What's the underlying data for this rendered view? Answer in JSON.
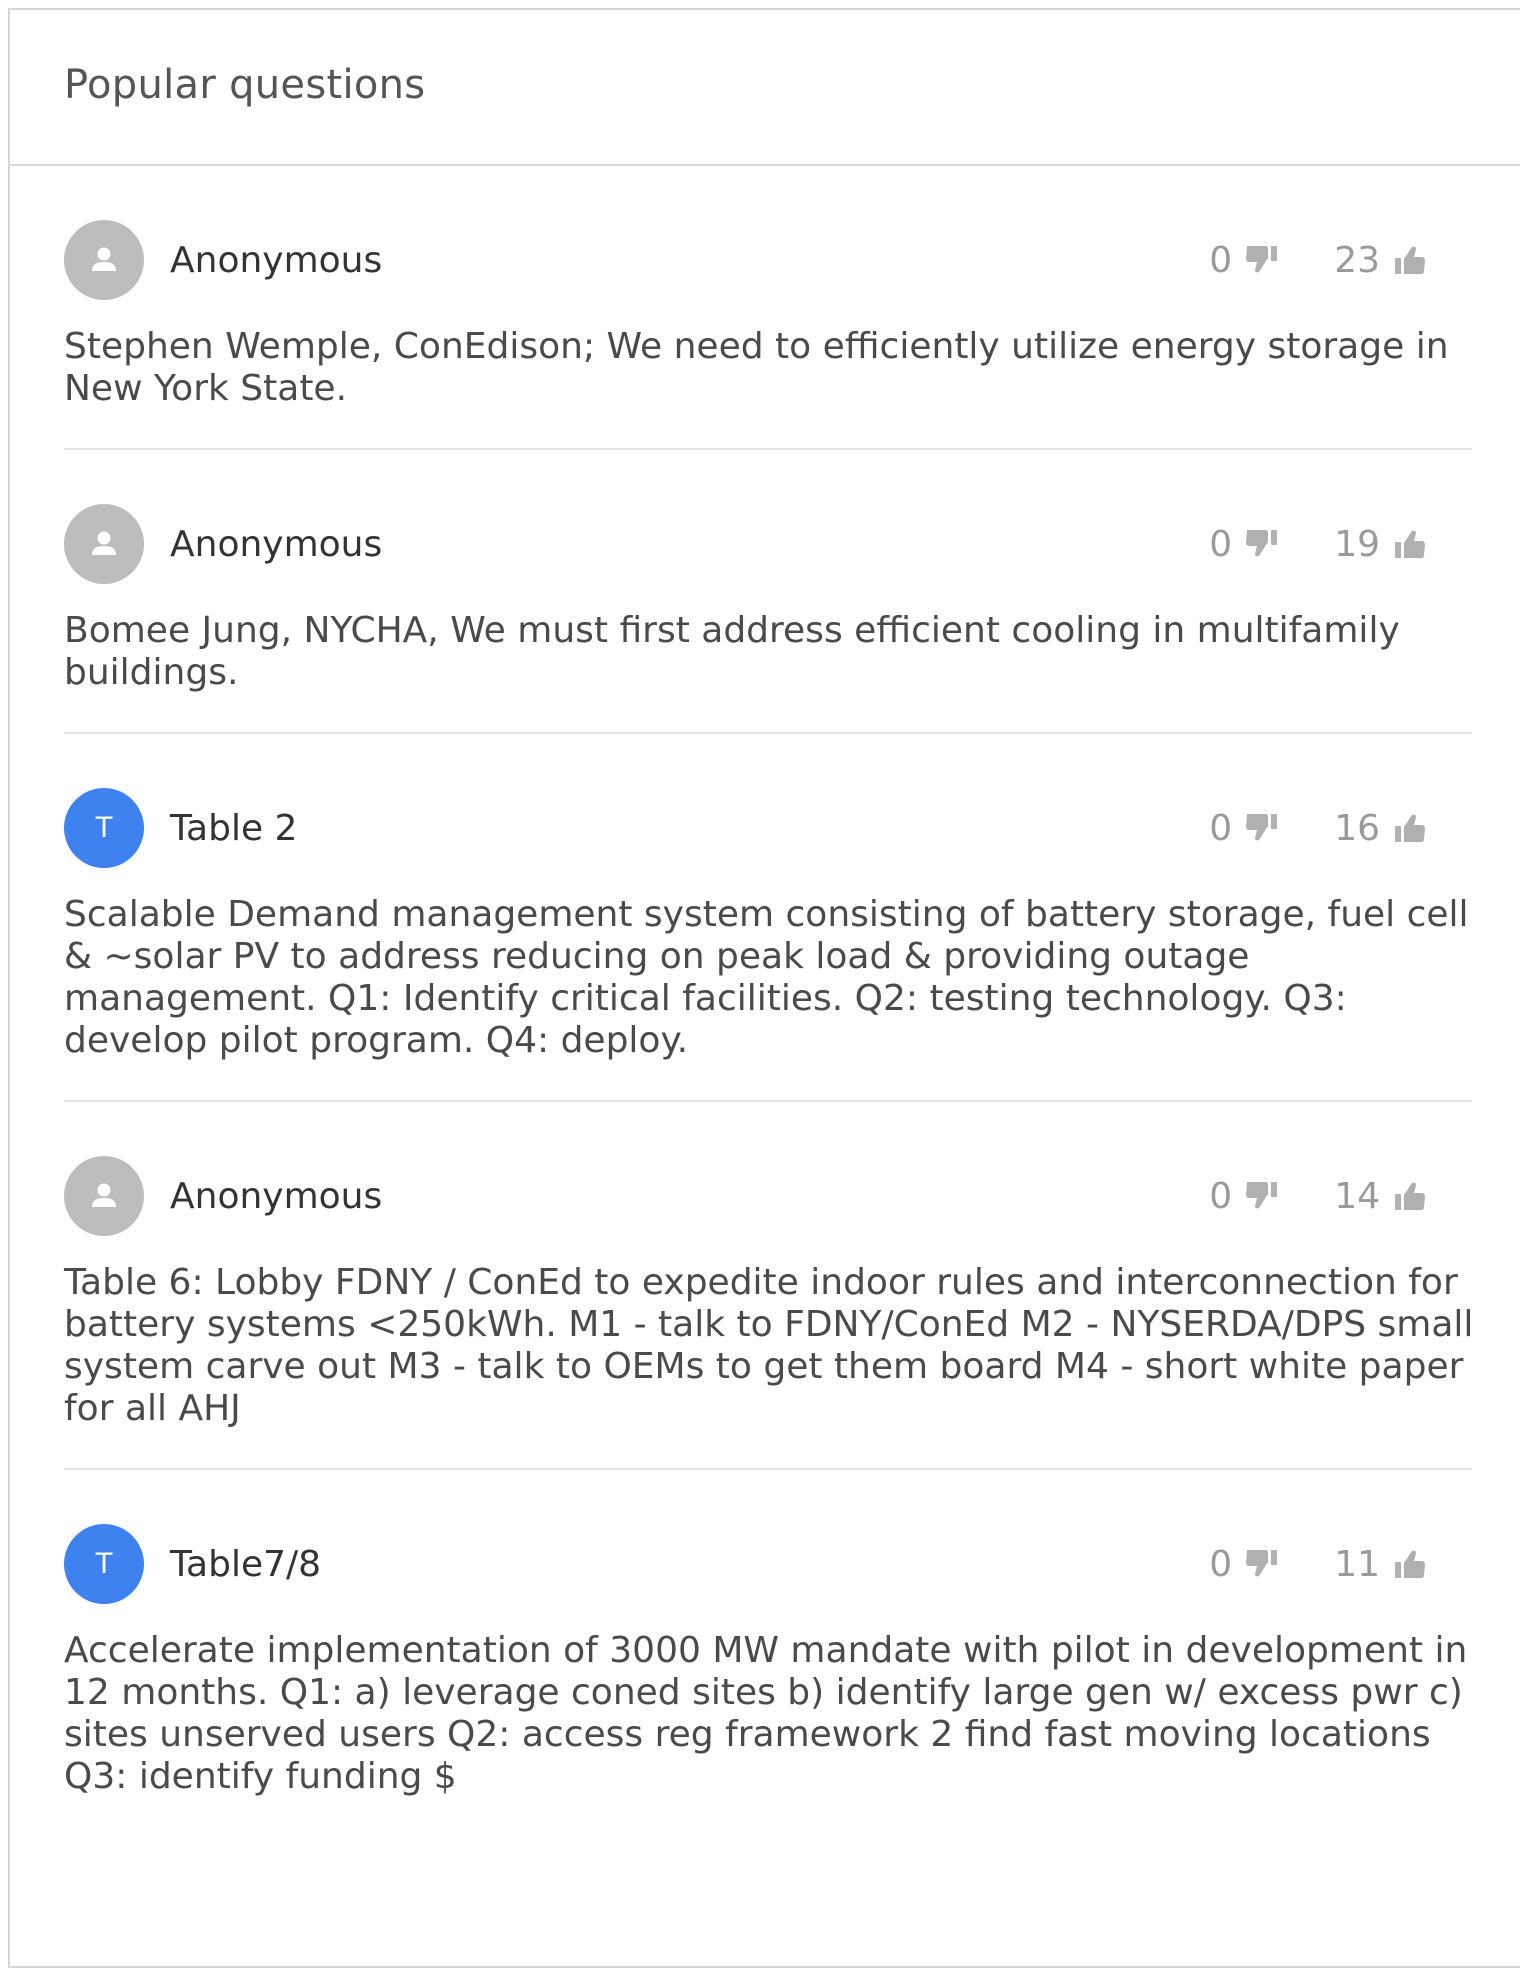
{
  "header": {
    "title": "Popular questions"
  },
  "questions": [
    {
      "author": "Anonymous",
      "avatar": "anonymous-user-icon",
      "avatar_letter": "",
      "downvotes": "0",
      "upvotes": "23",
      "text": "Stephen Wemple, ConEdison; We need to efficiently utilize energy storage in New York State."
    },
    {
      "author": "Anonymous",
      "avatar": "anonymous-user-icon",
      "avatar_letter": "",
      "downvotes": "0",
      "upvotes": "19",
      "text": "Bomee Jung, NYCHA, We must first address efficient cooling in multifamily buildings."
    },
    {
      "author": "Table 2",
      "avatar": "initial",
      "avatar_letter": "T",
      "downvotes": "0",
      "upvotes": "16",
      "text": "Scalable Demand management system consisting of battery storage, fuel cell & ~solar PV to address reducing on peak load & providing outage management. Q1: Identify critical facilities. Q2: testing technology. Q3: develop pilot program. Q4: deploy."
    },
    {
      "author": "Anonymous",
      "avatar": "anonymous-user-icon",
      "avatar_letter": "",
      "downvotes": "0",
      "upvotes": "14",
      "text": "Table 6: Lobby FDNY / ConEd to expedite indoor rules and interconnection for battery systems <250kWh. M1 - talk to FDNY/ConEd M2 - NYSERDA/DPS small system carve out M3 - talk to OEMs to get them board M4 - short white paper for all AHJ"
    },
    {
      "author": "Table7/8",
      "avatar": "initial",
      "avatar_letter": "T",
      "downvotes": "0",
      "upvotes": "11",
      "text": "Accelerate implementation of 3000 MW mandate with pilot in development in 12 months. Q1: a) leverage coned sites b) identify large gen w/ excess pwr c) sites unserved users Q2: access reg framework 2 find fast moving locations Q3: identify funding $"
    }
  ],
  "colors": {
    "initial_avatar": "#3d82ee",
    "anonymous_avatar": "#bdbdbd",
    "vote_gray": "#b0b0b0"
  }
}
